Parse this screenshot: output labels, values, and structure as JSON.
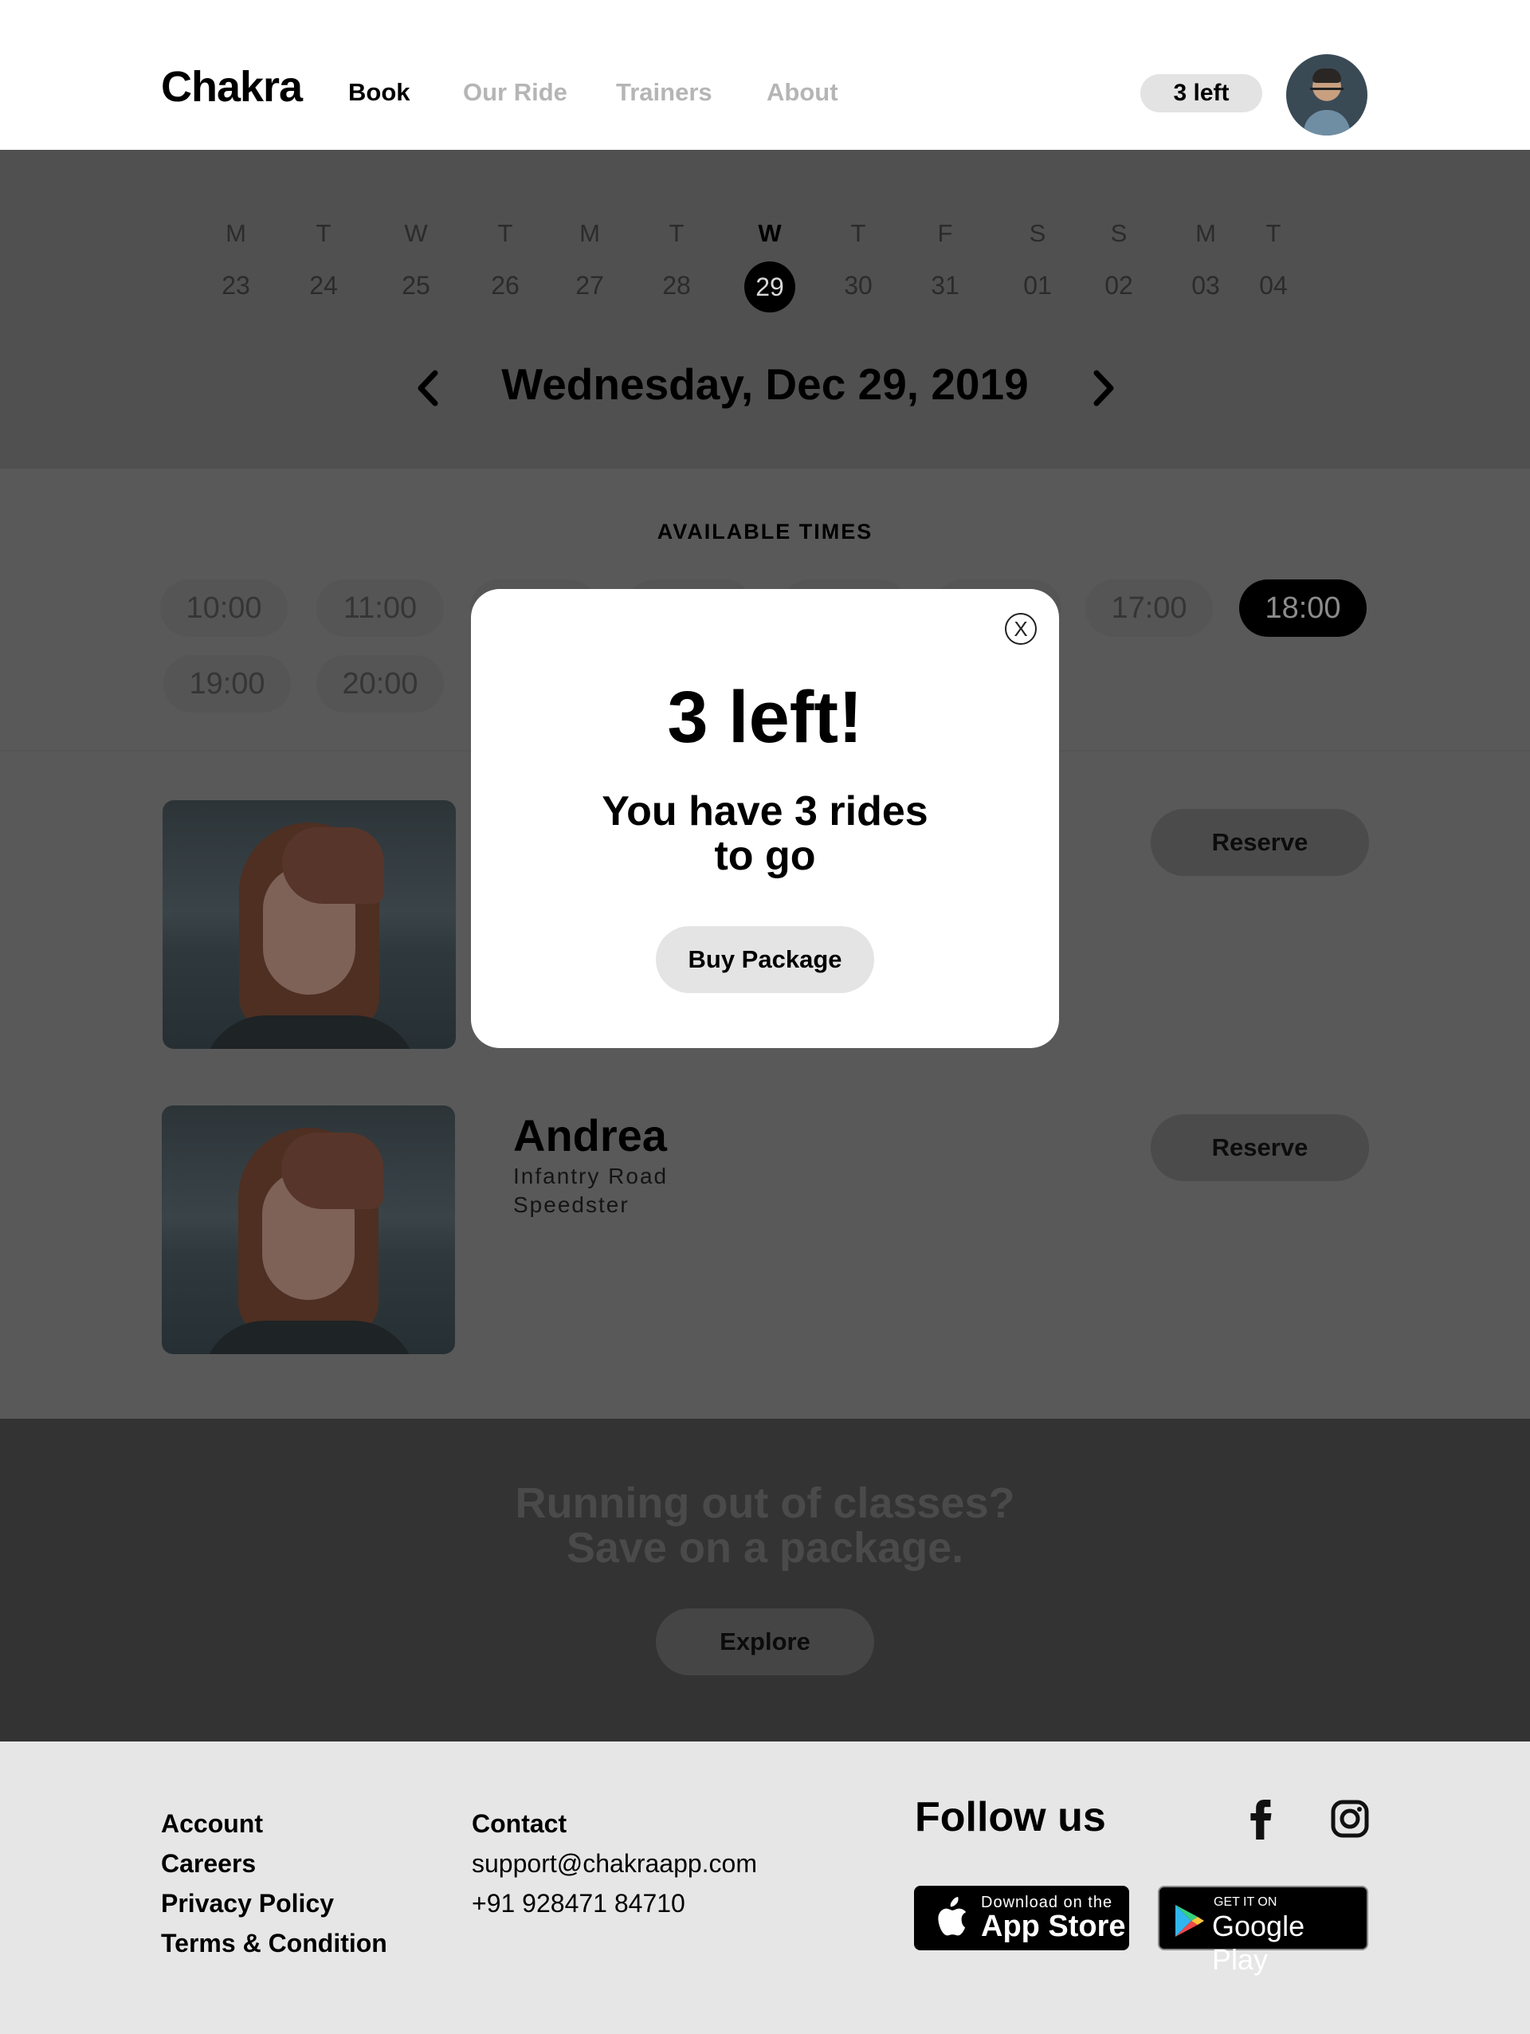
{
  "header": {
    "logo": "Chakra",
    "nav": [
      "Book",
      "Our Ride",
      "Trainers",
      "About"
    ],
    "credits": "3 left"
  },
  "calendar": {
    "days": [
      {
        "dow": "M",
        "date": "23"
      },
      {
        "dow": "T",
        "date": "24"
      },
      {
        "dow": "W",
        "date": "25"
      },
      {
        "dow": "T",
        "date": "26"
      },
      {
        "dow": "M",
        "date": "27"
      },
      {
        "dow": "T",
        "date": "28"
      },
      {
        "dow": "W",
        "date": "29"
      },
      {
        "dow": "T",
        "date": "30"
      },
      {
        "dow": "F",
        "date": "31"
      },
      {
        "dow": "S",
        "date": "01"
      },
      {
        "dow": "S",
        "date": "02"
      },
      {
        "dow": "M",
        "date": "03"
      },
      {
        "dow": "T",
        "date": "04"
      }
    ],
    "selected_date": "29",
    "current_date": "Wednesday, Dec 29, 2019"
  },
  "times": {
    "title": "AVAILABLE TIMES",
    "visible": [
      "10:00",
      "11:00",
      "17:00",
      "18:00",
      "19:00",
      "20:00"
    ],
    "selected": "18:00"
  },
  "riders": [
    {
      "name": "Andrea",
      "subtitle_line1": "Infantry Road",
      "subtitle_line2": "Speedster",
      "reserve_label": "Reserve"
    }
  ],
  "reserve_label": "Reserve",
  "promo": {
    "title_line1": "Running out of classes?",
    "title_line2": "Save on a package.",
    "button": "Explore"
  },
  "footer": {
    "links": [
      "Account",
      "Careers",
      "Privacy Policy",
      "Terms & Condition"
    ],
    "contact_title": "Contact",
    "email": "support@chakraapp.com",
    "phone": "+91 928471 84710",
    "follow_title": "Follow us",
    "appstore": {
      "small": "Download on the",
      "big": "App Store"
    },
    "googleplay": {
      "small": "GET IT ON",
      "big": "Google Play"
    }
  },
  "modal": {
    "close": "X",
    "title": "3 left!",
    "message_line1": "You have 3 rides",
    "message_line2": "to go",
    "button": "Buy Package"
  }
}
